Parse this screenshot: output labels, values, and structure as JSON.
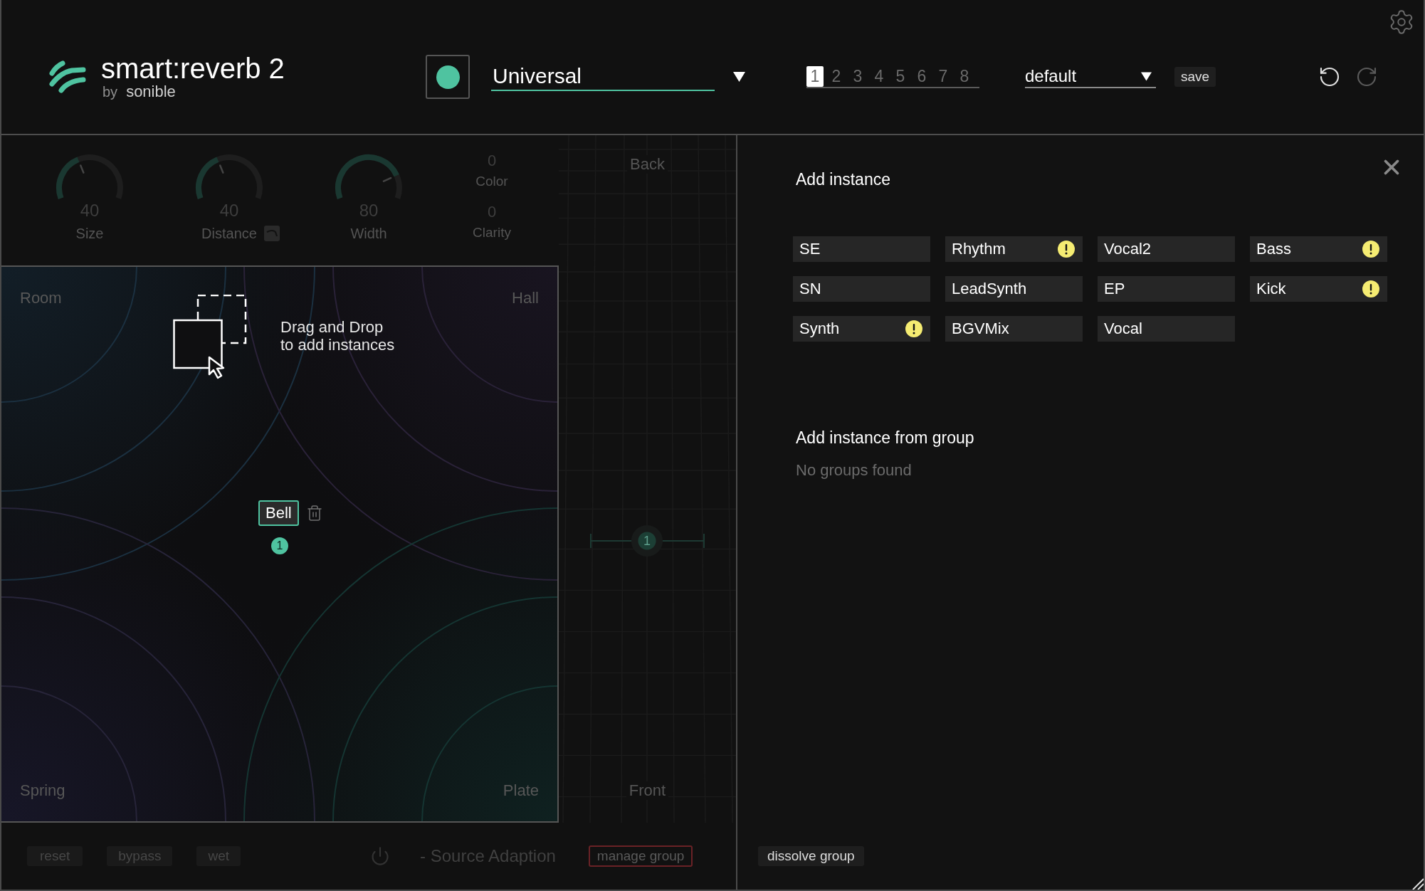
{
  "header": {
    "logo": {
      "product": "smart:reverb 2",
      "by": "by",
      "maker": "sonible"
    },
    "power": {
      "on": true
    },
    "profile": {
      "value": "Universal"
    },
    "instance_tabs": [
      {
        "label": "1",
        "selected": true
      },
      {
        "label": "2",
        "selected": false
      },
      {
        "label": "3",
        "selected": false
      },
      {
        "label": "4",
        "selected": false
      },
      {
        "label": "5",
        "selected": false
      },
      {
        "label": "6",
        "selected": false
      },
      {
        "label": "7",
        "selected": false
      },
      {
        "label": "8",
        "selected": false
      }
    ],
    "preset": {
      "value": "default"
    },
    "save": "save",
    "undo": {
      "disabled": false
    },
    "redo": {
      "disabled": true
    }
  },
  "parameters": [
    {
      "kind": "knob",
      "label": "Size",
      "value": "40",
      "level": 0.4,
      "option_button": false
    },
    {
      "kind": "knob",
      "label": "Distance",
      "value": "40",
      "level": 0.4,
      "option_button": true
    },
    {
      "kind": "knob",
      "label": "Width",
      "value": "80",
      "level": 0.8,
      "option_button": false
    },
    {
      "kind": "values",
      "items": [
        {
          "label": "Color",
          "value": "0"
        },
        {
          "label": "Clarity",
          "value": "0"
        }
      ]
    }
  ],
  "pad": {
    "corners": [
      "Room",
      "Hall",
      "Spring",
      "Plate"
    ],
    "hint": [
      "Drag and Drop",
      "to add instances"
    ],
    "instances": [
      {
        "name": "Bell",
        "number": "1"
      }
    ]
  },
  "depth": {
    "back": "Back",
    "front": "Front",
    "markers": [
      {
        "number": "1",
        "level": 0.41
      }
    ]
  },
  "footer": {
    "buttons": [
      "reset",
      "bypass",
      "wet"
    ],
    "source_adaption": {
      "label": "- Source Adaption",
      "on": false
    },
    "manage_group": "manage group"
  },
  "drawer": {
    "title": "Add instance",
    "instances": [
      {
        "name": "SE",
        "warning": false
      },
      {
        "name": "Rhythm",
        "warning": true
      },
      {
        "name": "Vocal2",
        "warning": false
      },
      {
        "name": "Bass",
        "warning": true
      },
      {
        "name": "SN",
        "warning": false
      },
      {
        "name": "LeadSynth",
        "warning": false
      },
      {
        "name": "EP",
        "warning": false
      },
      {
        "name": "Kick",
        "warning": true
      },
      {
        "name": "Synth",
        "warning": true
      },
      {
        "name": "BGVMix",
        "warning": false
      },
      {
        "name": "Vocal",
        "warning": false
      }
    ],
    "group_title": "Add instance from group",
    "group_empty": "No groups found",
    "dissolve": "dissolve group"
  }
}
